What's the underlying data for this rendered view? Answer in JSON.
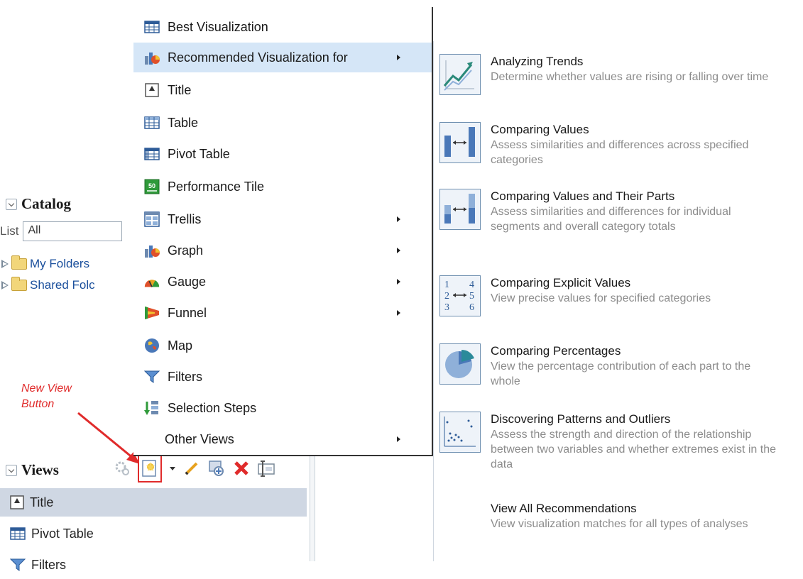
{
  "catalog": {
    "title": "Catalog",
    "list_label": "List",
    "list_value": "All",
    "folders": [
      "My Folders",
      "Shared Folc"
    ]
  },
  "annotation": {
    "line1": "New View",
    "line2": "Button"
  },
  "views": {
    "title": "Views",
    "rows": [
      "Title",
      "Pivot Table",
      "Filters"
    ]
  },
  "menu": {
    "items": [
      {
        "label": "Best Visualization",
        "icon": "table-grid-icon",
        "submenu": false
      },
      {
        "label": "Recommended Visualization for",
        "icon": "graph-icon",
        "submenu": true
      },
      {
        "label": "Title",
        "icon": "title-icon",
        "submenu": false
      },
      {
        "label": "Table",
        "icon": "table-icon",
        "submenu": false
      },
      {
        "label": "Pivot Table",
        "icon": "pivot-table-icon",
        "submenu": false
      },
      {
        "label": "Performance Tile",
        "icon": "performance-tile-icon",
        "submenu": false
      },
      {
        "label": "Trellis",
        "icon": "trellis-icon",
        "submenu": true
      },
      {
        "label": "Graph",
        "icon": "graph-icon",
        "submenu": true
      },
      {
        "label": "Gauge",
        "icon": "gauge-icon",
        "submenu": true
      },
      {
        "label": "Funnel",
        "icon": "funnel-icon",
        "submenu": true
      },
      {
        "label": "Map",
        "icon": "map-icon",
        "submenu": false
      },
      {
        "label": "Filters",
        "icon": "filter-icon",
        "submenu": false
      },
      {
        "label": "Selection Steps",
        "icon": "selection-steps-icon",
        "submenu": false
      },
      {
        "label": "Other Views",
        "icon": "",
        "submenu": true
      }
    ],
    "performance_tile_icon_text": "50"
  },
  "submenu": {
    "items": [
      {
        "title": "Analyzing Trends",
        "desc": "Determine whether values are rising or falling over time",
        "icon": "trend-line-icon"
      },
      {
        "title": "Comparing Values",
        "desc": "Assess similarities and differences across specified categories",
        "icon": "compare-bars-icon"
      },
      {
        "title": "Comparing Values and Their Parts",
        "desc": "Assess similarities and differences for individual segments and overall category totals",
        "icon": "stacked-compare-icon"
      },
      {
        "title": "Comparing Explicit Values",
        "desc": "View precise values for specified categories",
        "icon": "numbers-compare-icon"
      },
      {
        "title": "Comparing Percentages",
        "desc": "View the percentage contribution of each part to the whole",
        "icon": "pie-icon"
      },
      {
        "title": "Discovering Patterns and Outliers",
        "desc": "Assess the strength and direction of the relationship between two variables and whether extremes exist in the data",
        "icon": "scatter-icon"
      },
      {
        "title": "View All Recommendations",
        "desc": "View visualization matches for all types of analyses",
        "icon": ""
      }
    ],
    "explicit_numbers": [
      "1",
      "2",
      "3",
      "4",
      "5",
      "6"
    ]
  },
  "colors": {
    "highlight": "#d5e6f7",
    "accent_red": "#e02b2b",
    "link_blue": "#1a4f9c"
  }
}
